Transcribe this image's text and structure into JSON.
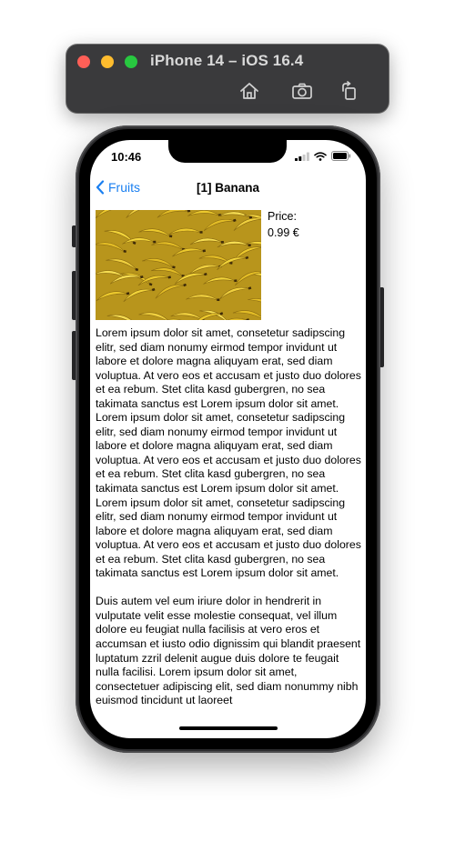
{
  "simulator": {
    "title": "iPhone 14 – iOS 16.4",
    "toolbar": {
      "home_icon": "home-icon",
      "screenshot_icon": "camera-icon",
      "rotate_icon": "rotate-icon"
    }
  },
  "status_bar": {
    "time": "10:46"
  },
  "nav": {
    "back_label": "Fruits",
    "title": "[1] Banana"
  },
  "product": {
    "image_name": "banana-image",
    "price_label": "Price:",
    "price_value": "0.99 €",
    "description": [
      "Lorem ipsum dolor sit amet, consetetur sadipscing elitr, sed diam nonumy eirmod tempor invidunt ut labore et dolore magna aliquyam erat, sed diam voluptua. At vero eos et accusam et justo duo dolores et ea rebum. Stet clita kasd gubergren, no sea takimata sanctus est Lorem ipsum dolor sit amet. Lorem ipsum dolor sit amet, consetetur sadipscing elitr, sed diam nonumy eirmod tempor invidunt ut labore et dolore magna aliquyam erat, sed diam voluptua. At vero eos et accusam et justo duo dolores et ea rebum. Stet clita kasd gubergren, no sea takimata sanctus est Lorem ipsum dolor sit amet. Lorem ipsum dolor sit amet, consetetur sadipscing elitr, sed diam nonumy eirmod tempor invidunt ut labore et dolore magna aliquyam erat, sed diam voluptua. At vero eos et accusam et justo duo dolores et ea rebum. Stet clita kasd gubergren, no sea takimata sanctus est Lorem ipsum dolor sit amet.",
      "Duis autem vel eum iriure dolor in hendrerit in vulputate velit esse molestie consequat, vel illum dolore eu feugiat nulla facilisis at vero eros et accumsan et iusto odio dignissim qui blandit praesent luptatum zzril delenit augue duis dolore te feugait nulla facilisi. Lorem ipsum dolor sit amet, consectetuer adipiscing elit, sed diam nonummy nibh euismod tincidunt ut laoreet"
    ]
  },
  "colors": {
    "accent": "#1a7ff0",
    "window_bar": "#3a3a3c",
    "banana_yellow": "#e8c832"
  }
}
